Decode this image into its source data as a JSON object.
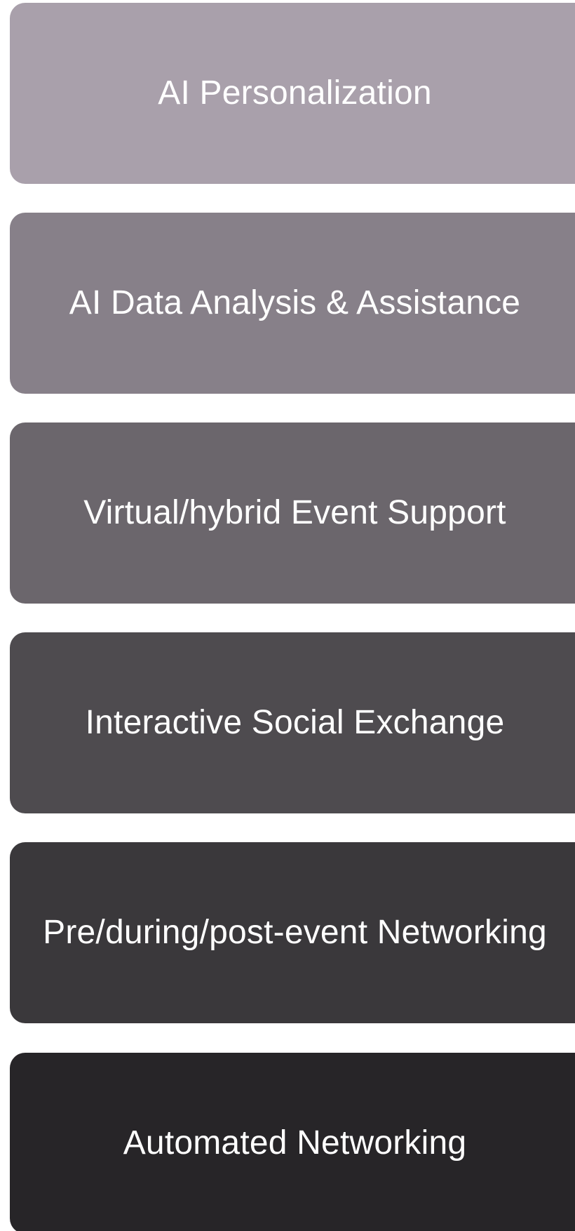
{
  "cards": [
    {
      "label": "AI Personalization",
      "color": "#a9a0ab"
    },
    {
      "label": "AI Data Analysis & Assistance",
      "color": "#878089"
    },
    {
      "label": "Virtual/hybrid Event Support",
      "color": "#6b666c"
    },
    {
      "label": "Interactive Social Exchange",
      "color": "#4e4b4f"
    },
    {
      "label": "Pre/during/post-event Networking",
      "color": "#3a383b"
    },
    {
      "label": "Automated Networking",
      "color": "#272528"
    }
  ]
}
